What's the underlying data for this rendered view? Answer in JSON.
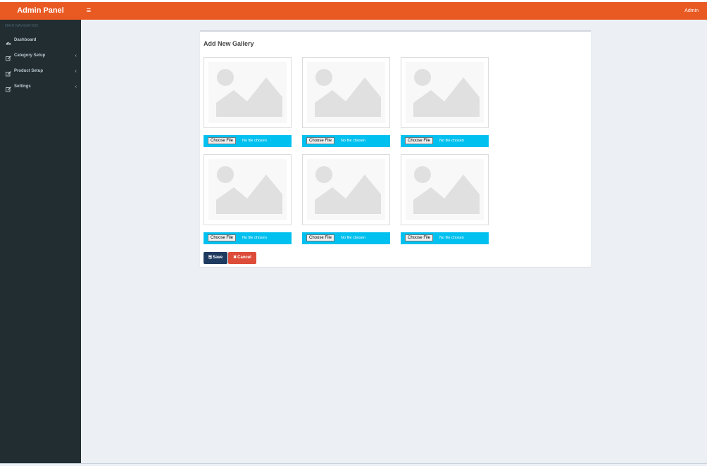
{
  "header": {
    "logo": "Admin Panel",
    "menu_icon": "hamburger-icon",
    "user": "Admin",
    "color": "#e95a23"
  },
  "sidebar": {
    "nav_header": "MAIN NAVIGATION",
    "items": [
      {
        "label": "Dashboard",
        "icon": "dashboard-icon",
        "has_children": false
      },
      {
        "label": "Category Setup",
        "icon": "edit-icon",
        "has_children": true
      },
      {
        "label": "Product Setup",
        "icon": "edit-icon",
        "has_children": true
      },
      {
        "label": "Settings",
        "icon": "edit-icon",
        "has_children": true
      }
    ],
    "color": "#222d32"
  },
  "main": {
    "title": "Add New Gallery",
    "uploads": [
      {
        "button": "Choose File",
        "status": "No file chosen"
      },
      {
        "button": "Choose File",
        "status": "No file chosen"
      },
      {
        "button": "Choose File",
        "status": "No file chosen"
      },
      {
        "button": "Choose File",
        "status": "No file chosen"
      },
      {
        "button": "Choose File",
        "status": "No file chosen"
      },
      {
        "button": "Choose File",
        "status": "No file chosen"
      }
    ],
    "save_label": "Save",
    "cancel_label": "Cancel",
    "accent": "#00c0ef"
  }
}
